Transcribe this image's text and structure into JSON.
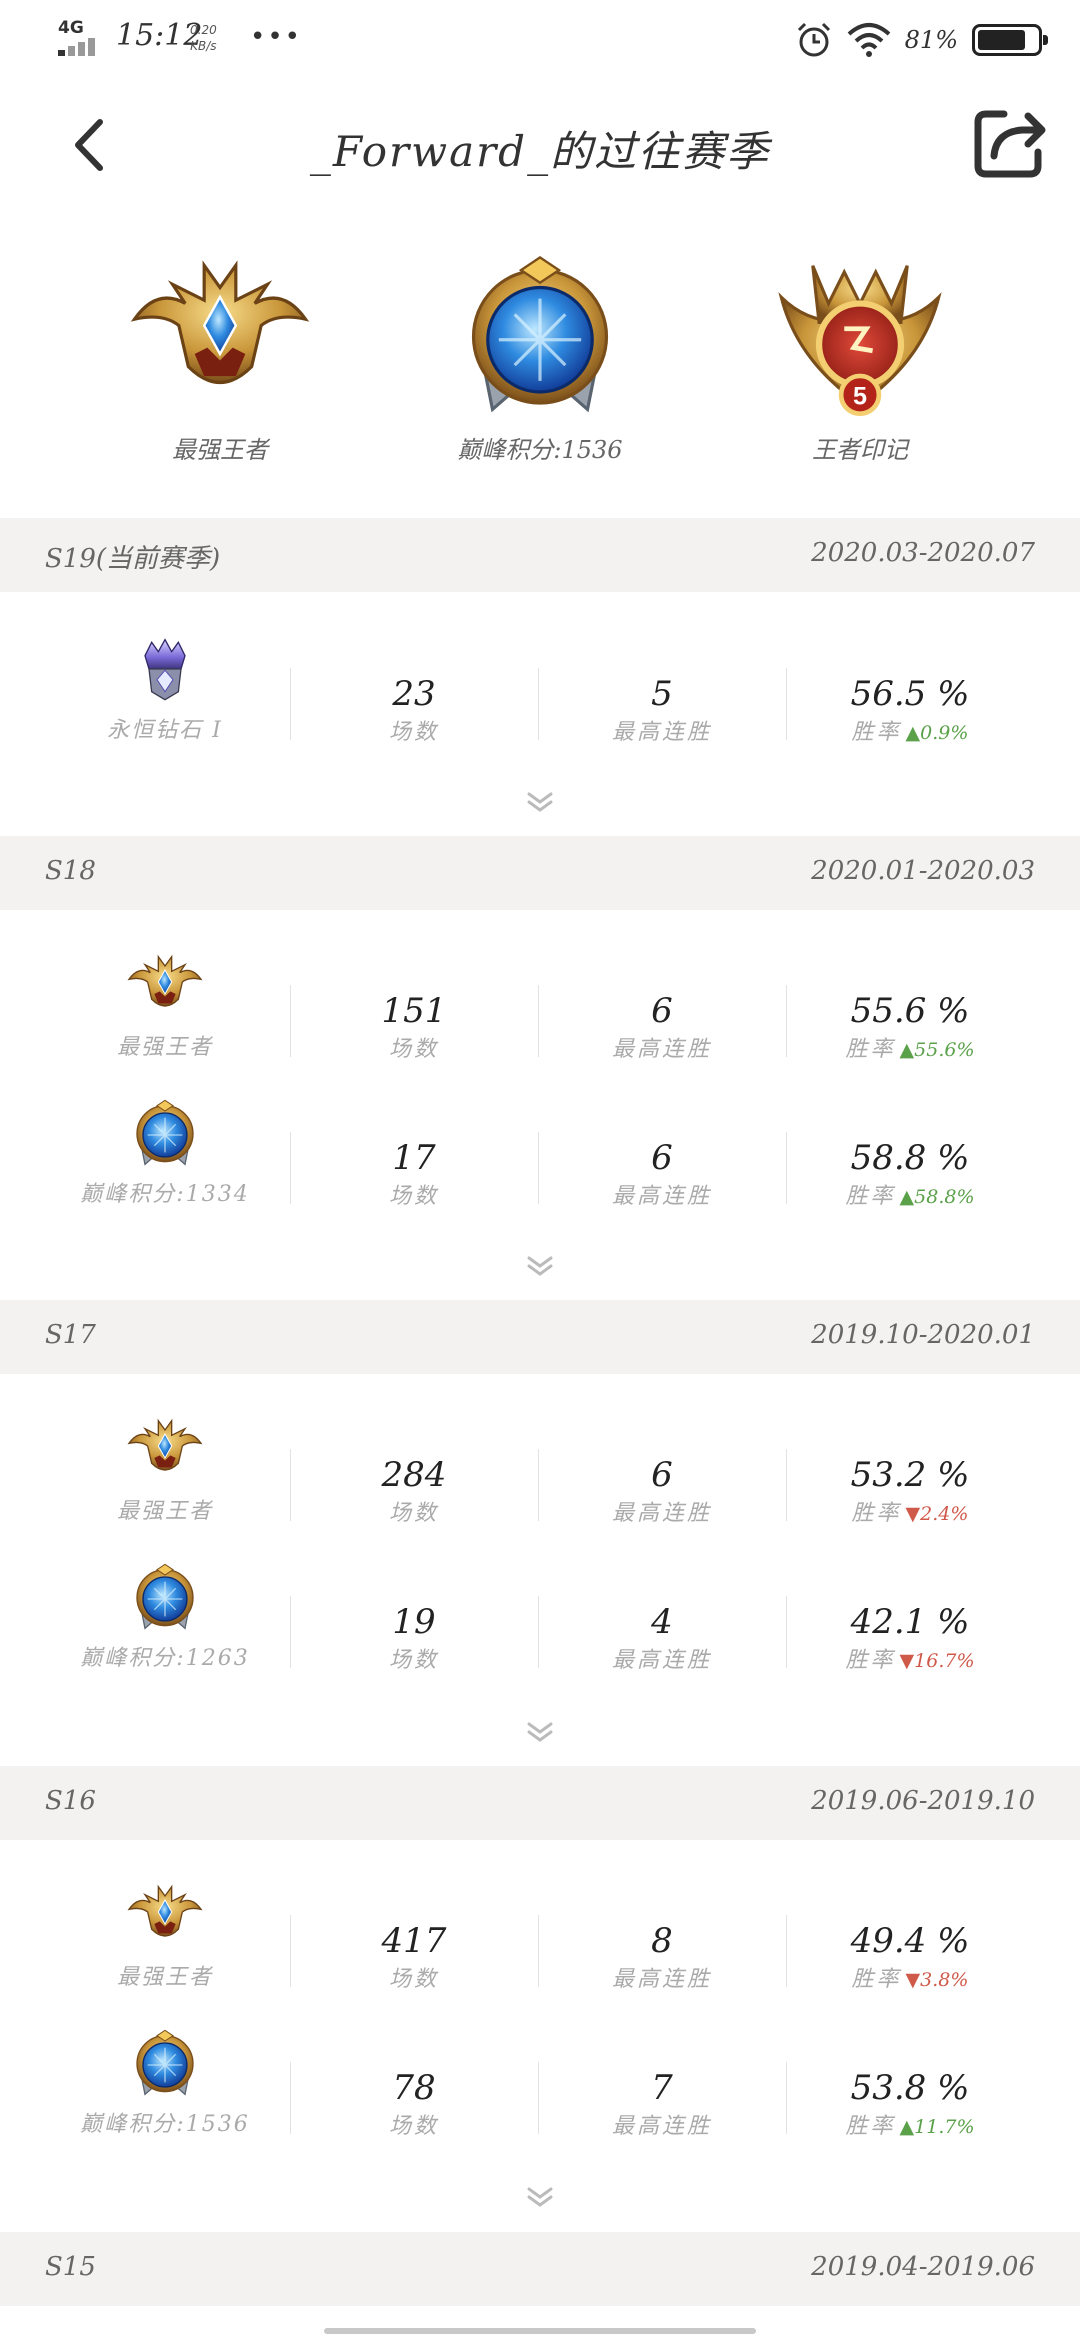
{
  "status_bar": {
    "network": "4G",
    "time": "15:12",
    "speed_value": "0.20",
    "speed_unit": "KB/s",
    "more": "•••",
    "battery_pct": "81%",
    "battery_level": 0.81
  },
  "header": {
    "title": "_Forward_的过往赛季"
  },
  "top_badges": [
    {
      "label": "最强王者",
      "icon": "king-helmet-icon"
    },
    {
      "label": "巅峰积分:1536",
      "icon": "peak-orb-icon"
    },
    {
      "label": "王者印记",
      "icon": "king-mark-icon"
    }
  ],
  "labels": {
    "matches": "场数",
    "streak": "最高连胜",
    "winrate": "胜率"
  },
  "seasons": [
    {
      "name": "S19(当前赛季)",
      "date": "2020.03-2020.07",
      "rows": [
        {
          "rank": "永恒钻石 I",
          "icon": "diamond-icon",
          "matches": "23",
          "streak": "5",
          "winrate": "56.5 %",
          "change": "0.9%",
          "trend": "up"
        }
      ]
    },
    {
      "name": "S18",
      "date": "2020.01-2020.03",
      "rows": [
        {
          "rank": "最强王者",
          "icon": "king-helmet-icon",
          "matches": "151",
          "streak": "6",
          "winrate": "55.6 %",
          "change": "55.6%",
          "trend": "up"
        },
        {
          "rank": "巅峰积分:1334",
          "icon": "peak-orb-icon",
          "matches": "17",
          "streak": "6",
          "winrate": "58.8 %",
          "change": "58.8%",
          "trend": "up"
        }
      ]
    },
    {
      "name": "S17",
      "date": "2019.10-2020.01",
      "rows": [
        {
          "rank": "最强王者",
          "icon": "king-helmet-icon",
          "matches": "284",
          "streak": "6",
          "winrate": "53.2 %",
          "change": "2.4%",
          "trend": "down"
        },
        {
          "rank": "巅峰积分:1263",
          "icon": "peak-orb-icon",
          "matches": "19",
          "streak": "4",
          "winrate": "42.1 %",
          "change": "16.7%",
          "trend": "down"
        }
      ]
    },
    {
      "name": "S16",
      "date": "2019.06-2019.10",
      "rows": [
        {
          "rank": "最强王者",
          "icon": "king-helmet-icon",
          "matches": "417",
          "streak": "8",
          "winrate": "49.4 %",
          "change": "3.8%",
          "trend": "down"
        },
        {
          "rank": "巅峰积分:1536",
          "icon": "peak-orb-icon",
          "matches": "78",
          "streak": "7",
          "winrate": "53.8 %",
          "change": "11.7%",
          "trend": "up"
        }
      ]
    },
    {
      "name": "S15",
      "date": "2019.04-2019.06",
      "rows": []
    }
  ],
  "colors": {
    "up": "#5aa14a",
    "down": "#d05a4a",
    "section_bg": "#f3f2f0"
  }
}
